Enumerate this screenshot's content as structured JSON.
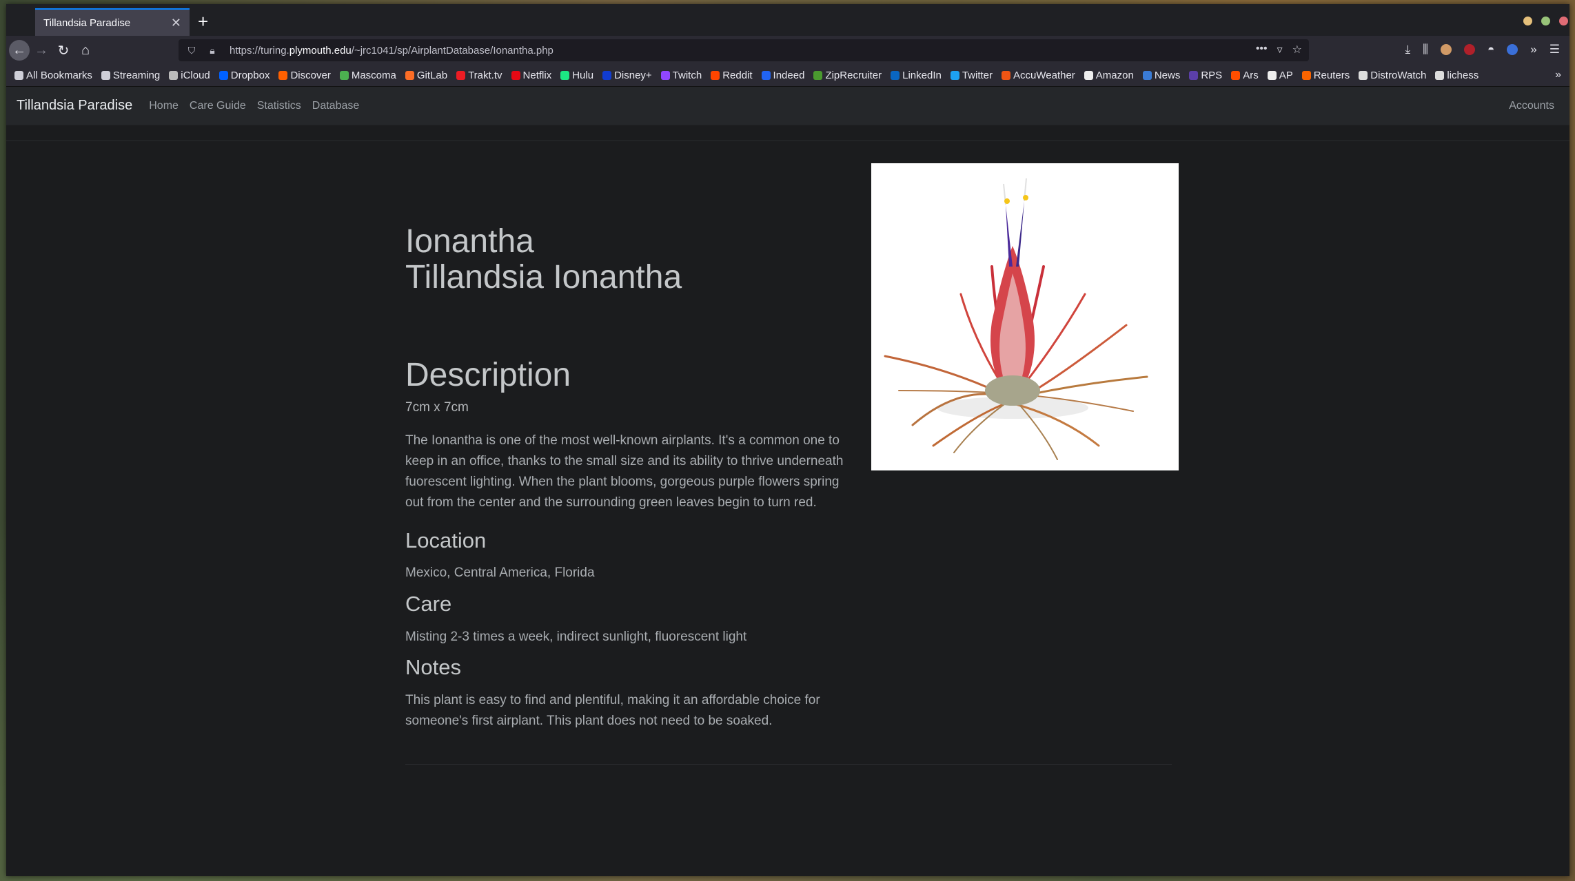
{
  "browser": {
    "tab_title": "Tillandsia Paradise",
    "url_prefix": "https://turing.",
    "url_host": "plymouth.edu",
    "url_path": "/~jrc1041/sp/AirplantDatabase/Ionantha.php"
  },
  "bookmarks": [
    {
      "label": "All Bookmarks",
      "icon": "folder-icon",
      "color": "#cfcfd8"
    },
    {
      "label": "Streaming",
      "icon": "folder-icon",
      "color": "#cfcfd8"
    },
    {
      "label": "iCloud",
      "icon": "apple-icon",
      "color": "#bbbbbb"
    },
    {
      "label": "Dropbox",
      "icon": "dropbox-icon",
      "color": "#0061ff"
    },
    {
      "label": "Discover",
      "icon": "discover-icon",
      "color": "#ff6000"
    },
    {
      "label": "Mascoma",
      "icon": "mascoma-icon",
      "color": "#4caf50"
    },
    {
      "label": "GitLab",
      "icon": "gitlab-icon",
      "color": "#fc6d26"
    },
    {
      "label": "Trakt.tv",
      "icon": "trakt-icon",
      "color": "#ed1c24"
    },
    {
      "label": "Netflix",
      "icon": "netflix-icon",
      "color": "#e50914"
    },
    {
      "label": "Hulu",
      "icon": "hulu-icon",
      "color": "#1ce783"
    },
    {
      "label": "Disney+",
      "icon": "disney-icon",
      "color": "#113ccf"
    },
    {
      "label": "Twitch",
      "icon": "twitch-icon",
      "color": "#9146ff"
    },
    {
      "label": "Reddit",
      "icon": "reddit-icon",
      "color": "#ff4500"
    },
    {
      "label": "Indeed",
      "icon": "indeed-icon",
      "color": "#2164f3"
    },
    {
      "label": "ZipRecruiter",
      "icon": "ziprecruiter-icon",
      "color": "#4a9a2f"
    },
    {
      "label": "LinkedIn",
      "icon": "linkedin-icon",
      "color": "#0a66c2"
    },
    {
      "label": "Twitter",
      "icon": "twitter-icon",
      "color": "#1da1f2"
    },
    {
      "label": "AccuWeather",
      "icon": "accuweather-icon",
      "color": "#f05514"
    },
    {
      "label": "Amazon",
      "icon": "amazon-icon",
      "color": "#eeeeee"
    },
    {
      "label": "News",
      "icon": "news-icon",
      "color": "#3a7bd5"
    },
    {
      "label": "RPS",
      "icon": "rps-icon",
      "color": "#5b3fa8"
    },
    {
      "label": "Ars",
      "icon": "ars-icon",
      "color": "#ff4e00"
    },
    {
      "label": "AP",
      "icon": "ap-icon",
      "color": "#eeeeee"
    },
    {
      "label": "Reuters",
      "icon": "reuters-icon",
      "color": "#fa6400"
    },
    {
      "label": "DistroWatch",
      "icon": "distrowatch-icon",
      "color": "#dddddd"
    },
    {
      "label": "lichess",
      "icon": "lichess-icon",
      "color": "#dddddd"
    }
  ],
  "site": {
    "brand": "Tillandsia Paradise",
    "nav": [
      "Home",
      "Care Guide",
      "Statistics",
      "Database"
    ],
    "accounts": "Accounts"
  },
  "plant": {
    "common_name": "Ionantha",
    "scientific_name": "Tillandsia Ionantha",
    "description_heading": "Description",
    "size": "7cm x 7cm",
    "description": "The Ionantha is one of the most well-known airplants. It's a common one to keep in an office, thanks to the small size and its ability to thrive underneath fuorescent lighting. When the plant blooms, gorgeous purple flowers spring out from the center and the surrounding green leaves begin to turn red.",
    "location_heading": "Location",
    "location": "Mexico, Central America, Florida",
    "care_heading": "Care",
    "care": "Misting 2-3 times a week, indirect sunlight, fluorescent light",
    "notes_heading": "Notes",
    "notes": "This plant is easy to find and plentiful, making it an affordable choice for someone's first airplant. This plant does not need to be soaked."
  },
  "colors": {
    "accent": "#0a84ff",
    "page_bg": "#1b1c1e",
    "navbar_bg": "#25272a"
  }
}
